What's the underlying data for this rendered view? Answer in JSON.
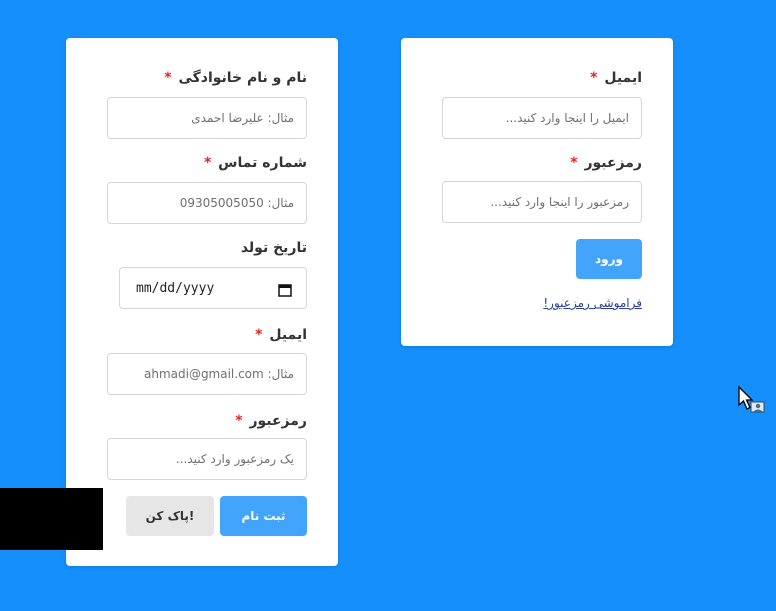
{
  "colors": {
    "background": "#148ffb",
    "primary_button": "#42a5fb",
    "required_star": "#e02424",
    "link": "#2a3f9e"
  },
  "register": {
    "fullname_label": "نام و نام خانوادگی",
    "fullname_placeholder": "مثال: علیرضا احمدی",
    "phone_label": "شماره تماس",
    "phone_placeholder": "مثال: 09305005050",
    "birthdate_label": "تاریخ تولد",
    "birthdate_value": "mm/dd/yyyy",
    "email_label": "ایمیل",
    "email_placeholder": "مثال: ahmadi@gmail.com",
    "password_label": "رمزعبور",
    "password_placeholder": "یک رمزعبور وارد کنید...",
    "submit_label": "ثبت نام",
    "clear_label": "پاک کن!"
  },
  "login": {
    "email_label": "ایمیل",
    "email_placeholder": "ایمیل را اینجا وارد کنید...",
    "password_label": "رمزعبور",
    "password_placeholder": "رمزعبور را اینجا وارد کنید...",
    "submit_label": "ورود",
    "forgot_link": "فراموشی رمزعبور!"
  },
  "required_mark": "*",
  "icons": [
    "calendar-icon",
    "cursor-icon"
  ]
}
